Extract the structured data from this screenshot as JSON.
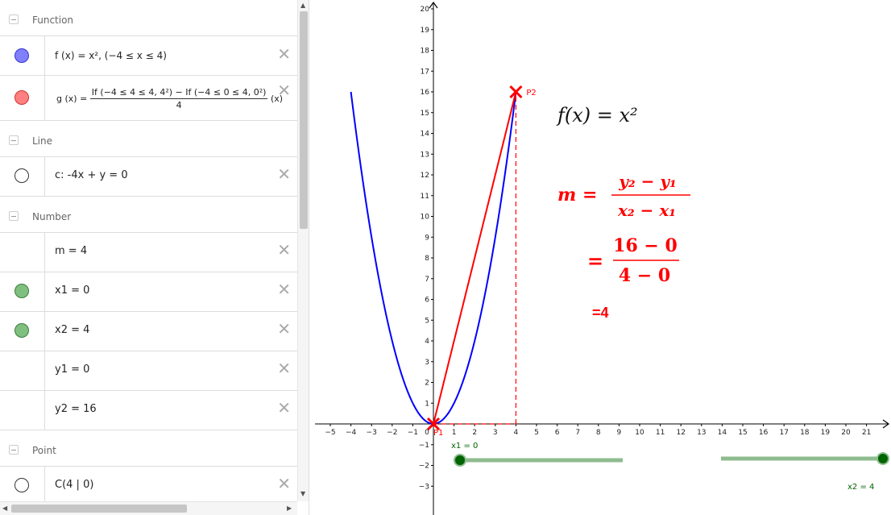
{
  "algebra": {
    "categories": {
      "function": "Function",
      "line": "Line",
      "number": "Number",
      "point": "Point"
    },
    "f": {
      "name": "f",
      "text": "f (x)  =  x², (−4 ≤ x ≤ 4)",
      "color": "#8080ff"
    },
    "g": {
      "prefix": "g (x)  =",
      "numerator": "If (−4 ≤ 4 ≤ 4, 4²) − If (−4 ≤ 0 ≤ 4, 0²)",
      "denominator": "4",
      "suffix": "(x)",
      "color": "#ff8080"
    },
    "c": {
      "text": "c: -4x + y = 0"
    },
    "m": {
      "text": "m = 4"
    },
    "x1": {
      "text": "x1 = 0",
      "color": "#7fbf7f"
    },
    "x2": {
      "text": "x2 = 4",
      "color": "#7fbf7f"
    },
    "y1": {
      "text": "y1 = 0"
    },
    "y2": {
      "text": "y2 = 16"
    },
    "C": {
      "text": "C(4 | 0)"
    }
  },
  "graphics": {
    "x_ticks": [
      "−5",
      "−4",
      "−3",
      "−2",
      "−1",
      "0",
      "1",
      "2",
      "3",
      "4",
      "5",
      "6",
      "7",
      "8",
      "9",
      "10",
      "11",
      "12",
      "13",
      "14",
      "15",
      "16",
      "17",
      "18",
      "19",
      "20",
      "21"
    ],
    "y_ticks": [
      "20",
      "19",
      "18",
      "17",
      "16",
      "15",
      "14",
      "13",
      "12",
      "11",
      "10",
      "9",
      "8",
      "7",
      "6",
      "5",
      "4",
      "3",
      "2",
      "1",
      "−1",
      "−2",
      "−3"
    ],
    "point_labels": {
      "p1": "P1",
      "p2": "P2"
    },
    "slider_labels": {
      "x1": "x1 = 0",
      "x2": "x2 = 4"
    },
    "text_formula": "f(x) = x²",
    "slope_lhs": "m =",
    "slope_num": "y₂ − y₁",
    "slope_den": "x₂ − x₁",
    "subst_eq": "=",
    "subst_num": "16 − 0",
    "subst_den": "4 − 0",
    "result": "=4",
    "colors": {
      "curve": "#0000ff",
      "line": "#ff0000",
      "slider": "#8fbc8f",
      "slider_dot": "#006400",
      "text_red": "#ff0000"
    }
  },
  "chart_data": {
    "type": "line",
    "xlim": [
      -5.5,
      21.9
    ],
    "ylim": [
      -4,
      20
    ],
    "series": [
      {
        "name": "f",
        "function": "x^2",
        "domain": [
          -4,
          4
        ],
        "color": "#0000ff"
      },
      {
        "name": "c",
        "points": [
          [
            0,
            0
          ],
          [
            4,
            16
          ]
        ],
        "color": "#ff0000"
      }
    ],
    "points": [
      {
        "name": "P1",
        "x": 0,
        "y": 0
      },
      {
        "name": "P2",
        "x": 4,
        "y": 16
      }
    ],
    "dashed": [
      [
        [
          4,
          0
        ],
        [
          4,
          16
        ]
      ],
      [
        [
          0,
          0
        ],
        [
          4,
          0
        ]
      ]
    ]
  }
}
